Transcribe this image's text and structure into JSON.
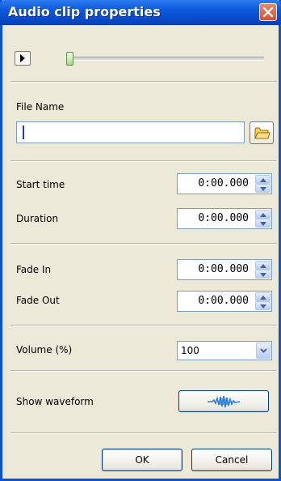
{
  "window": {
    "title": "Audio clip properties"
  },
  "player": {
    "position_fraction": 0.0
  },
  "file": {
    "label": "File Name",
    "value": ""
  },
  "timing": {
    "start_label": "Start time",
    "start_value": "0:00.000",
    "duration_label": "Duration",
    "duration_value": "0:00.000"
  },
  "fades": {
    "fade_in_label": "Fade In",
    "fade_in_value": "0:00.000",
    "fade_out_label": "Fade Out",
    "fade_out_value": "0:00.000"
  },
  "volume": {
    "label": "Volume (%)",
    "selected": "100"
  },
  "waveform": {
    "label": "Show waveform"
  },
  "buttons": {
    "ok": "OK",
    "cancel": "Cancel"
  },
  "colors": {
    "title_bar": "#0b58dd",
    "close_button": "#d4532e",
    "dialog_background": "#ece9d8",
    "waveform_icon": "#2a7fd8"
  },
  "icons": {
    "play": "play-icon",
    "close": "close-icon",
    "browse": "folder-icon",
    "waveform": "waveform-icon",
    "spin_up": "arrow-up-icon",
    "spin_down": "arrow-down-icon",
    "dropdown": "chevron-down-icon"
  }
}
